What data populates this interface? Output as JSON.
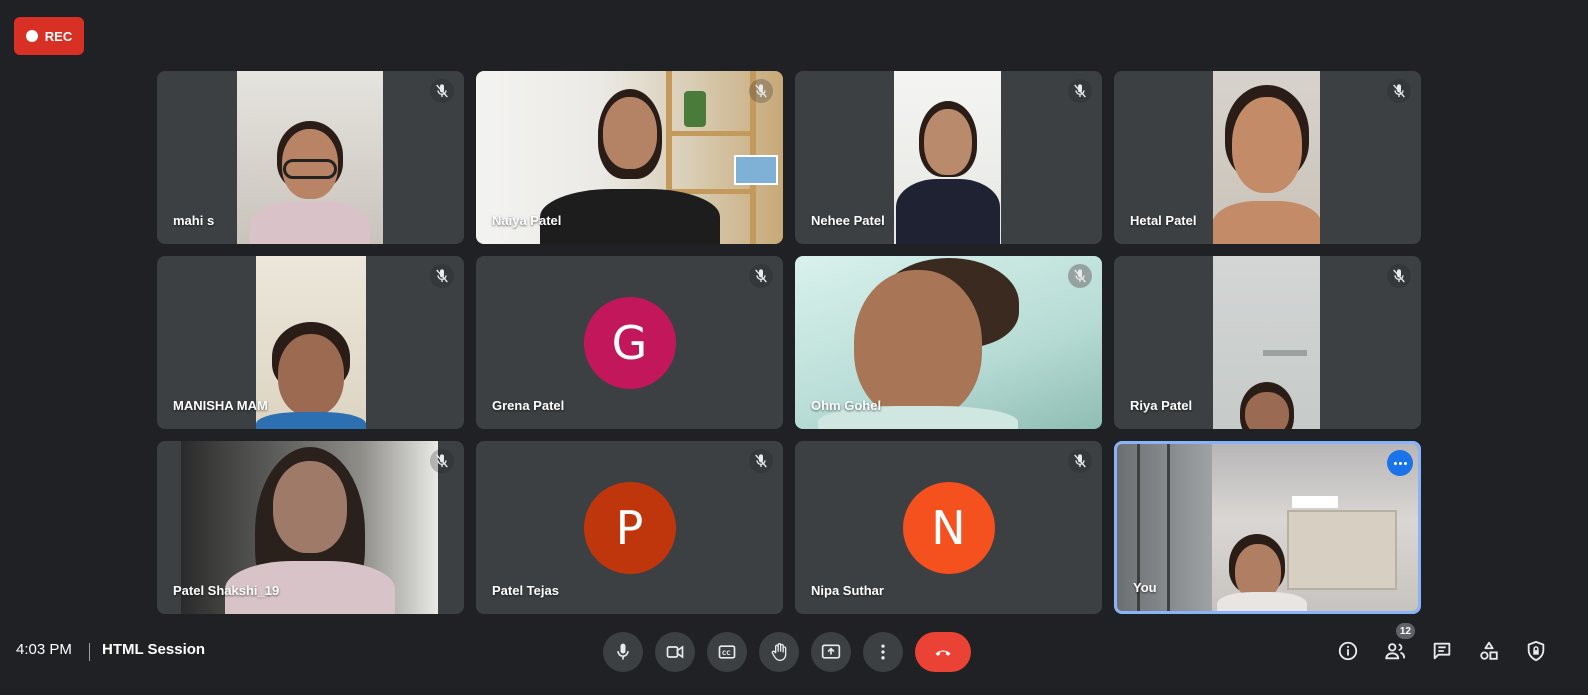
{
  "recording": {
    "label": "REC"
  },
  "participants": [
    {
      "name": "mahi s"
    },
    {
      "name": "Naiya Patel"
    },
    {
      "name": "Nehee Patel"
    },
    {
      "name": "Hetal Patel"
    },
    {
      "name": "MANISHA MAM"
    },
    {
      "name": "Grena Patel",
      "initial": "G",
      "avatar_color": "#c2185b"
    },
    {
      "name": "Ohm Gohel"
    },
    {
      "name": "Riya Patel"
    },
    {
      "name": "Patel Shakshi_19"
    },
    {
      "name": "Patel Tejas",
      "initial": "P",
      "avatar_color": "#bf360c"
    },
    {
      "name": "Nipa Suthar",
      "initial": "N",
      "avatar_color": "#f4511e"
    },
    {
      "name": "You"
    }
  ],
  "footer": {
    "time": "4:03 PM",
    "meeting_title": "HTML Session",
    "people_count": "12"
  },
  "colors": {
    "background": "#202124",
    "tile": "#3c4043",
    "end_call": "#ea4335",
    "rec": "#d93025",
    "self_border": "#8ab4f8"
  },
  "controls": [
    "microphone-icon",
    "camera-icon",
    "captions-icon",
    "raise-hand-icon",
    "present-icon",
    "more-options-icon",
    "end-call-icon"
  ],
  "side_controls": [
    "info-icon",
    "people-icon",
    "chat-icon",
    "activities-icon",
    "host-controls-icon"
  ]
}
